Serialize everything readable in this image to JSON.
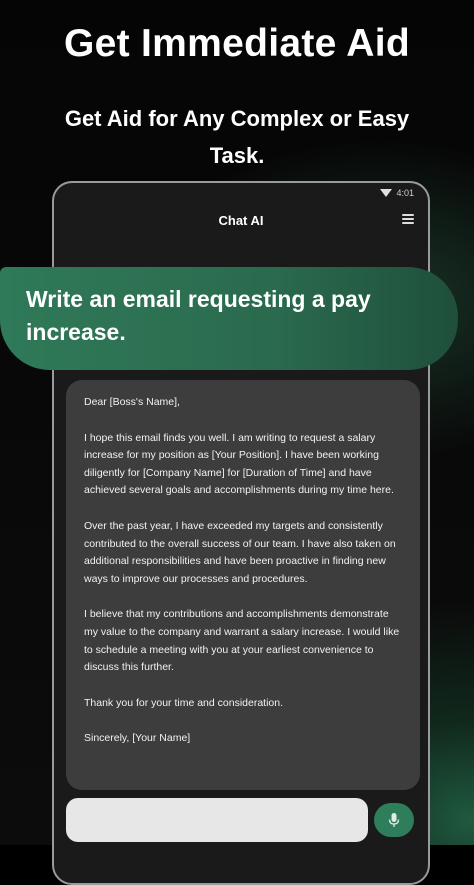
{
  "headline": "Get Immediate Aid",
  "subheadline": "Get Aid for Any Complex or Easy Task.",
  "phone": {
    "status_time": "4:01",
    "app_title": "Chat AI",
    "menu_icon": "hamburger-menu-icon",
    "prompt": "Write an email requesting a pay increase.",
    "response": {
      "greeting": "Dear [Boss's Name],",
      "paragraphs": [
        "I hope this email finds you well. I am writing to request a salary increase for my position as [Your Position]. I have been working diligently for [Company Name] for [Duration of Time] and have achieved several goals and accomplishments during my time here.",
        "Over the past year, I have exceeded my targets and consistently contributed to the overall success of our team. I have also taken on additional responsibilities and have been proactive in finding new ways to improve our processes and procedures.",
        "I believe that my contributions and accomplishments demonstrate my value to the company and warrant a salary increase. I would like to schedule a meeting with you at your earliest convenience to discuss this further.",
        "Thank you for your time and consideration."
      ],
      "signoff": "Sincerely, [Your Name]"
    },
    "input_placeholder": "",
    "mic_icon": "microphone-icon",
    "colors": {
      "accent": "#2e7d5b",
      "card": "#3d3d3d",
      "bubble": "#2f7a58"
    }
  }
}
